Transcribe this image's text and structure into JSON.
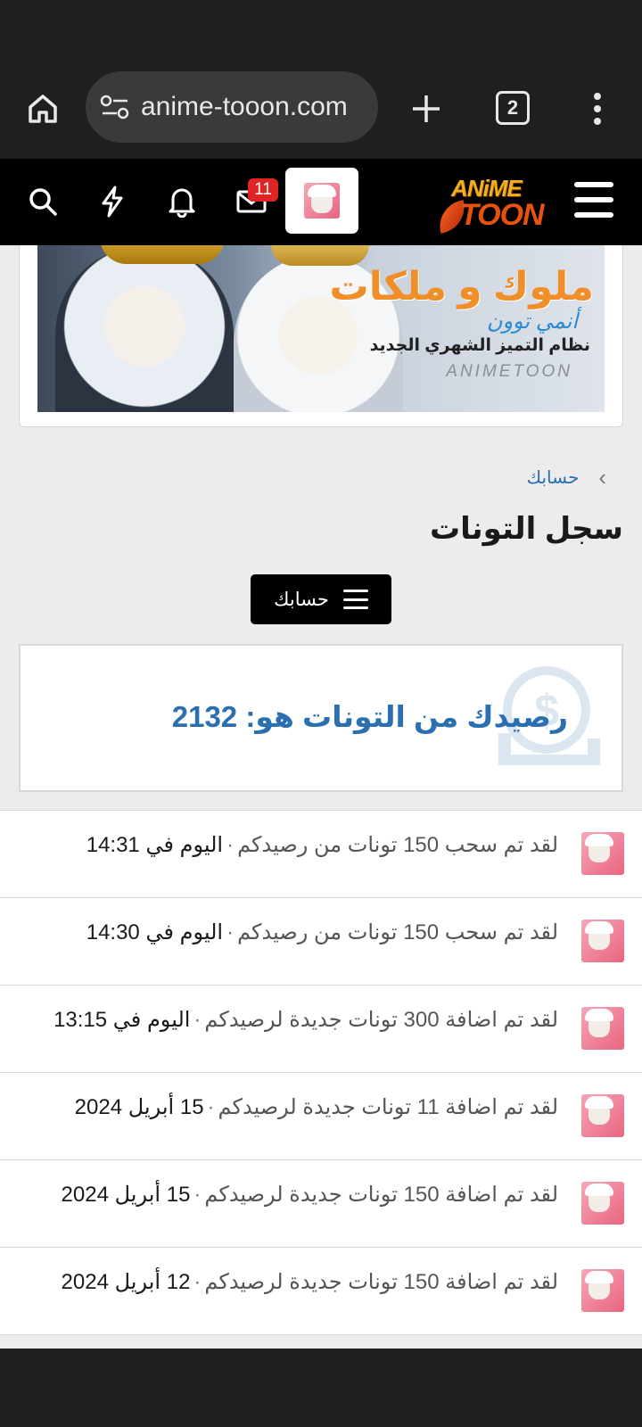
{
  "browser": {
    "url": "anime-tooon.com",
    "tab_count": "2"
  },
  "header": {
    "mail_badge": "11",
    "logo_line1": "ANiME",
    "logo_line2": "TOON"
  },
  "banner": {
    "title": "ملوك و ملكات",
    "subtitle": "أنمي توون",
    "line": "نظام التميز الشهري الجديد",
    "brand": "ANIMETOON"
  },
  "breadcrumb": {
    "item": "حسابك"
  },
  "page": {
    "title": "سجل التونات",
    "account_button": "حسابك"
  },
  "balance": {
    "text": "رصيدك من التونات هو: 2132"
  },
  "transactions": [
    {
      "message": "لقد تم سحب 150 تونات من رصيدكم",
      "date": "اليوم في 14:31"
    },
    {
      "message": "لقد تم سحب 150 تونات من رصيدكم",
      "date": "اليوم في 14:30"
    },
    {
      "message": "لقد تم اضافة 300 تونات جديدة لرصيدكم",
      "date": "اليوم في 13:15"
    },
    {
      "message": "لقد تم اضافة 11 تونات جديدة لرصيدكم",
      "date": "15 أبريل 2024"
    },
    {
      "message": "لقد تم اضافة 150 تونات جديدة لرصيدكم",
      "date": "15 أبريل 2024"
    },
    {
      "message": "لقد تم اضافة 150 تونات جديدة لرصيدكم",
      "date": "12 أبريل 2024"
    }
  ],
  "separator": "·",
  "colors": {
    "link_blue": "#2a6fb0",
    "badge_red": "#e02424",
    "header_bg": "#000000"
  }
}
